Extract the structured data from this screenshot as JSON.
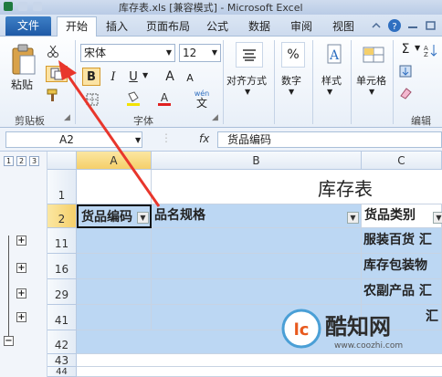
{
  "window": {
    "title": "库存表.xls [兼容模式] - Microsoft Excel"
  },
  "tabs": {
    "file": "文件",
    "home": "开始",
    "insert": "插入",
    "layout": "页面布局",
    "formulas": "公式",
    "data": "数据",
    "review": "审阅",
    "view": "视图"
  },
  "ribbon": {
    "paste": "粘贴",
    "clipboard": "剪贴板",
    "font_name": "宋体",
    "font_size": "12",
    "bold": "B",
    "italic": "I",
    "underline": "U",
    "grow_font": "A",
    "shrink_font": "A",
    "font_group": "字体",
    "align": "对齐方式",
    "number": "数字",
    "percent": "%",
    "styles": "样式",
    "cells": "单元格",
    "edit_group": "编辑",
    "wen": "wén",
    "wen_char": "文"
  },
  "formula_bar": {
    "name_box": "A2",
    "fx": "fx",
    "content": "货品编码"
  },
  "grid": {
    "levels": [
      "1",
      "2",
      "3"
    ],
    "columns": [
      "A",
      "B",
      "C"
    ],
    "rows": [
      "1",
      "2",
      "11",
      "16",
      "29",
      "41",
      "42",
      "43",
      "44"
    ],
    "title": "库存表",
    "headers": {
      "a": "货品编码",
      "b": "品名规格",
      "c": "货品类别"
    },
    "c_values": [
      "服装百货 汇",
      "库存包装物",
      "农副产品 汇",
      "汇"
    ],
    "outline_plus": "+",
    "outline_minus": "−",
    "dd_arrow": "▼"
  },
  "watermark": {
    "brand": "酷知网",
    "url": "www.coozhi.com"
  },
  "colors": {
    "accent_blue": "#bcd7f3",
    "header_select": "#f5cf6a",
    "file_tab": "#1f5aa6",
    "arrow_red": "#e8362c"
  },
  "icons": [
    "excel-icon",
    "save-icon",
    "undo-icon",
    "help-icon",
    "cut-icon",
    "copy-icon",
    "format-painter-icon",
    "paste-icon",
    "borders-icon",
    "fill-color-icon",
    "font-color-icon",
    "align-icon",
    "percent-icon",
    "styles-icon",
    "cells-icon",
    "sum-icon",
    "sort-icon",
    "clear-icon"
  ]
}
